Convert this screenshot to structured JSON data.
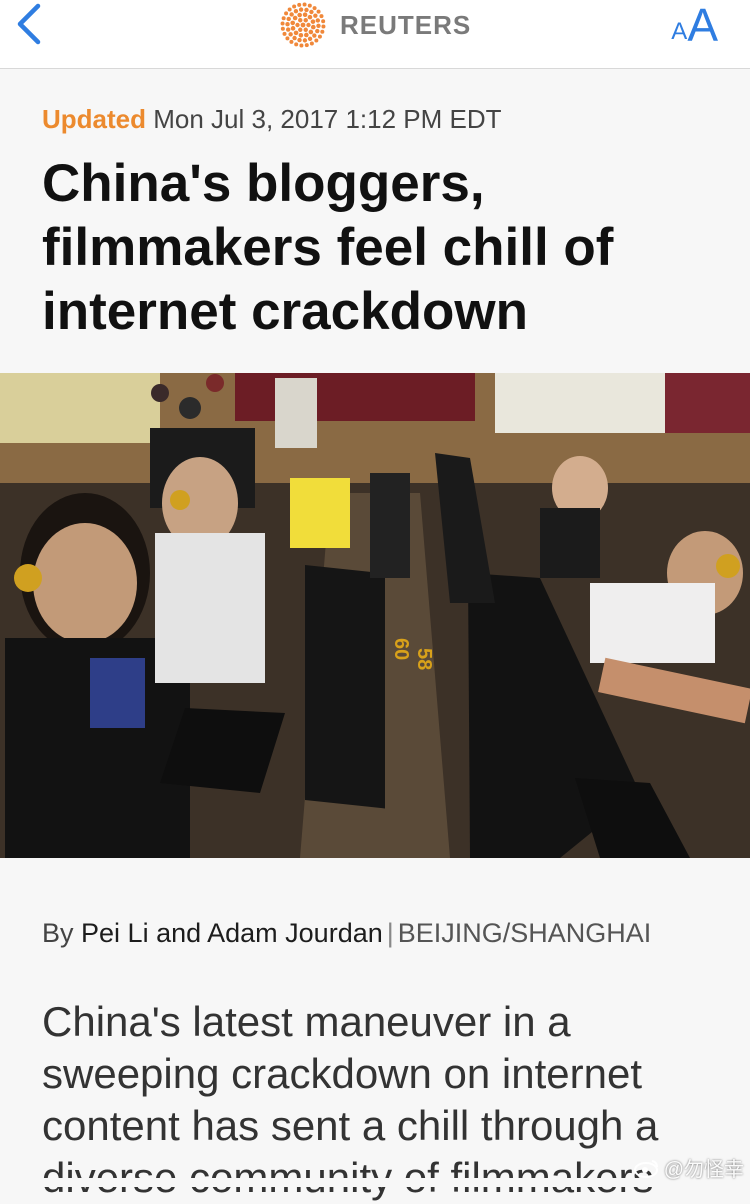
{
  "nav": {
    "back_icon": "chevron-left-icon",
    "brand_logo": "reuters-dot-logo",
    "brand_name": "REUTERS",
    "text_size_small": "A",
    "text_size_large": "A",
    "accent_color": "#2f7de1"
  },
  "article": {
    "updated_label": "Updated",
    "timestamp": "Mon Jul 3, 2017 1:12 PM EDT",
    "headline": "China's bloggers, filmmakers feel chill of internet crackdown",
    "byline_prefix": "By",
    "authors": "Pei Li and Adam Jourdan",
    "byline_separator": "|",
    "location": "BEIJING/SHANGHAI",
    "lead": "China's latest maneuver in a sweeping crackdown on internet content has sent a chill through a diverse community of filmmakers",
    "updated_color": "#ec8a2e"
  },
  "hero_image": {
    "monitor_labels": [
      "60",
      "58"
    ]
  },
  "watermark": {
    "logo": "weibo-logo",
    "text": "@勿怪幸"
  }
}
